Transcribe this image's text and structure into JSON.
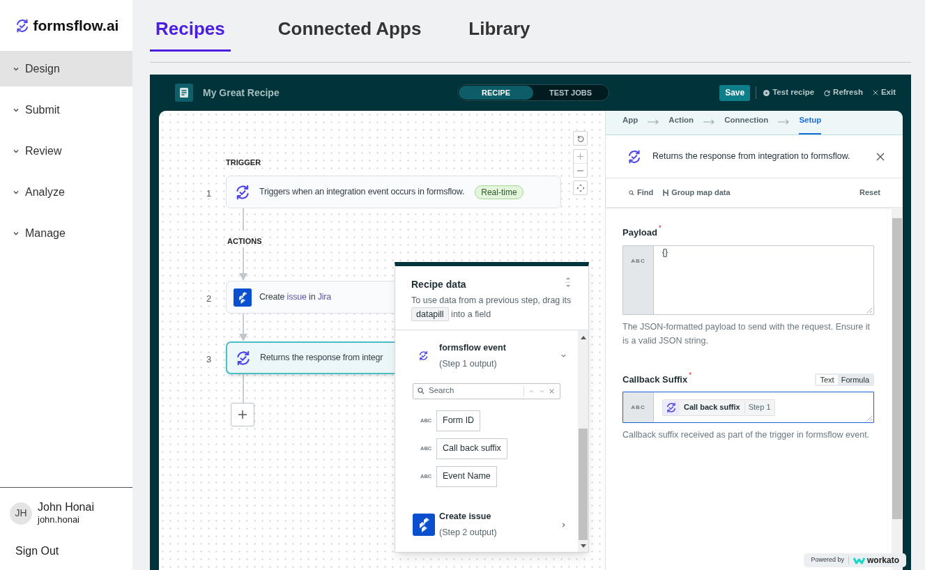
{
  "logo": {
    "text": "formsflow.ai"
  },
  "sidebar": {
    "items": [
      {
        "label": "Design",
        "selected": true
      },
      {
        "label": "Submit",
        "selected": false
      },
      {
        "label": "Review",
        "selected": false
      },
      {
        "label": "Analyze",
        "selected": false
      },
      {
        "label": "Manage",
        "selected": false
      }
    ]
  },
  "user": {
    "initials": "JH",
    "name": "John Honai",
    "email": "john.honai"
  },
  "sign_out": "Sign Out",
  "tabs": [
    {
      "label": "Recipes",
      "selected": true
    },
    {
      "label": "Connected Apps",
      "selected": false
    },
    {
      "label": "Library",
      "selected": false
    }
  ],
  "recipe_header": {
    "title": "My Great Recipe",
    "modes": [
      {
        "label": "RECIPE",
        "selected": true
      },
      {
        "label": "TEST JOBS",
        "selected": false
      }
    ],
    "actions": [
      {
        "kind": "save",
        "label": "Save"
      },
      {
        "kind": "test",
        "label": "Test recipe"
      },
      {
        "kind": "refresh",
        "label": "Refresh"
      },
      {
        "kind": "exit",
        "label": "Exit"
      }
    ]
  },
  "canvas": {
    "trigger_label": "TRIGGER",
    "actions_label": "ACTIONS",
    "steps": [
      {
        "number": "1",
        "kind": "formsflow",
        "selected": false,
        "parts": [
          {
            "text": "Triggers when an integration event occurs in formsflow.",
            "kind": "plain"
          }
        ],
        "badge": "Real-time"
      },
      {
        "number": "2",
        "kind": "jira",
        "selected": false,
        "parts": [
          {
            "text": "Create ",
            "kind": "plain"
          },
          {
            "text": "issue",
            "kind": "link"
          },
          {
            "text": " in ",
            "kind": "plain"
          },
          {
            "text": "Jira",
            "kind": "link"
          }
        ]
      },
      {
        "number": "3",
        "kind": "formsflow",
        "selected": true,
        "parts": [
          {
            "text": "Returns the response from integr",
            "kind": "plain"
          }
        ]
      }
    ]
  },
  "recipe_data": {
    "title": "Recipe data",
    "hint_before": "To use data from a previous step, drag its",
    "pill": "datapill",
    "hint_after": "into a field",
    "groups": [
      {
        "kind": "formsflow",
        "title": "formsflow event",
        "subtitle": "(Step 1 output)",
        "expanded": true,
        "search_placeholder": "Search",
        "fields": [
          {
            "type": "ABC",
            "label": "Form ID"
          },
          {
            "type": "ABC",
            "label": "Call back suffix"
          },
          {
            "type": "ABC",
            "label": "Event Name"
          }
        ]
      },
      {
        "kind": "jira",
        "title": "Create issue",
        "subtitle": "(Step 2 output)",
        "expanded": false
      }
    ]
  },
  "setup": {
    "steps": [
      {
        "label": "App",
        "selected": false
      },
      {
        "label": "Action",
        "selected": false
      },
      {
        "label": "Connection",
        "selected": false
      },
      {
        "label": "Setup",
        "selected": true
      }
    ],
    "title": "Returns the response from integration to formsflow.",
    "toolbar": {
      "find": "Find",
      "group": "Group map data",
      "reset": "Reset"
    },
    "fields": [
      {
        "label": "Payload",
        "required_mark": "*",
        "type": "ABC",
        "focused": false,
        "value": "{}",
        "hint": "The JSON-formatted payload to send with the request. Ensure it is a valid JSON string."
      },
      {
        "label": "Callback Suffix",
        "required_mark": "*",
        "type": "ABC",
        "focused": true,
        "modes": [
          {
            "label": "Text",
            "selected": true
          },
          {
            "label": "Formula",
            "selected": false
          }
        ],
        "pill": {
          "label": "Call back suffix",
          "step": "Step 1"
        },
        "hint": "Callback suffix received as part of the trigger in formsflow event."
      }
    ]
  },
  "powered_by": {
    "text": "Powered by",
    "brand": "workato"
  }
}
